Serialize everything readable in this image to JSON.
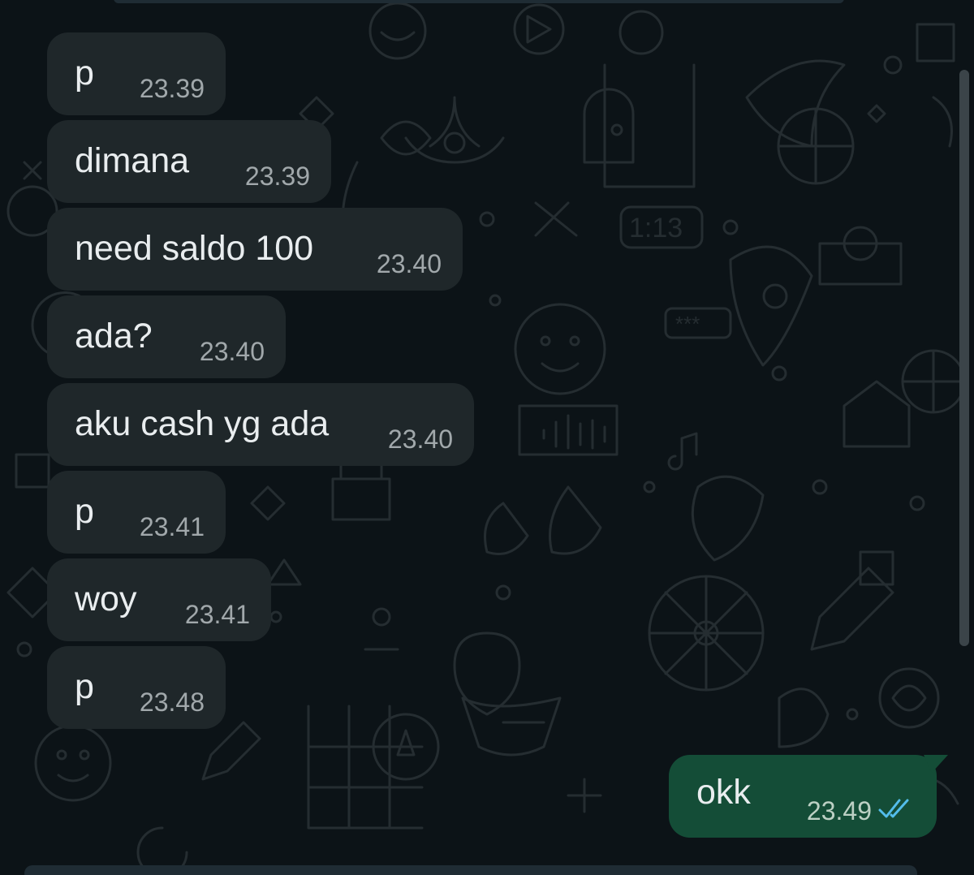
{
  "messages": [
    {
      "text": "p",
      "time": "23.39",
      "direction": "in"
    },
    {
      "text": "dimana",
      "time": "23.39",
      "direction": "in"
    },
    {
      "text": "need saldo 100",
      "time": "23.40",
      "direction": "in"
    },
    {
      "text": "ada?",
      "time": "23.40",
      "direction": "in"
    },
    {
      "text": "aku cash yg ada",
      "time": "23.40",
      "direction": "in"
    },
    {
      "text": "p",
      "time": "23.41",
      "direction": "in"
    },
    {
      "text": "woy",
      "time": "23.41",
      "direction": "in"
    },
    {
      "text": "p",
      "time": "23.48",
      "direction": "in"
    },
    {
      "text": "okk",
      "time": "23.49",
      "direction": "out",
      "status": "read-double-check"
    }
  ],
  "colors": {
    "background": "#0c1317",
    "incoming_bubble": "#1f272a",
    "outgoing_bubble": "#144d37",
    "read_ticks": "#53bdeb",
    "timestamp": "#a1a8ab"
  },
  "icons": {
    "read_status": "double-check-icon",
    "wallpaper": "doodle-pattern"
  }
}
